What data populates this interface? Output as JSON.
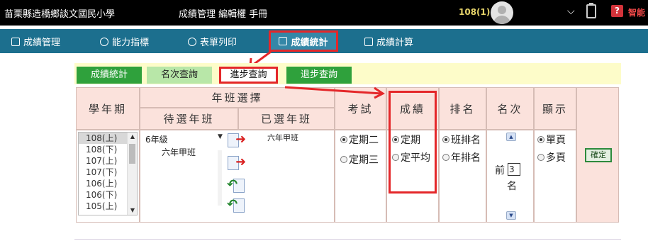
{
  "header": {
    "school": "苗栗縣造橋鄉談文國民小學",
    "system": "成績管理 編輯權 手冊",
    "account_year": "108(1)",
    "smart_label": "智能"
  },
  "nav": {
    "items": [
      {
        "label": "成績管理",
        "icon": "document-icon"
      },
      {
        "label": "能力指標",
        "icon": "target-icon"
      },
      {
        "label": "表單列印",
        "icon": "printer-icon"
      },
      {
        "label": "成績統計",
        "icon": "stats-icon",
        "active": true
      },
      {
        "label": "成績計算",
        "icon": "calculator-icon"
      }
    ]
  },
  "subtabs": [
    {
      "label": "成績統計"
    },
    {
      "label": "名次查詢"
    },
    {
      "label": "進步查詢",
      "active": true
    },
    {
      "label": "退步查詢"
    }
  ],
  "form": {
    "term_label": "學年期",
    "class_select_label": "年班選擇",
    "pending_label": "待選年班",
    "selected_label": "已選年班",
    "exam_label": "考試",
    "score_label": "成績",
    "order_label": "排名",
    "rank_label": "名次",
    "display_label": "顯示",
    "terms": [
      "108(上)",
      "108(下)",
      "107(上)",
      "107(下)",
      "106(上)",
      "106(下)",
      "105(上)",
      "105(下)"
    ],
    "grade_value": "6年級",
    "pending_classes": [
      "六年甲班"
    ],
    "selected_classes": [
      "六年甲班"
    ],
    "exam_options": [
      "定期二",
      "定期三"
    ],
    "score_options": [
      "定期",
      "定平均"
    ],
    "order_options": [
      "班排名",
      "年排名"
    ],
    "rank_prefix": "前",
    "rank_value": "3",
    "rank_suffix": "名",
    "display_options": [
      "單頁",
      "多頁"
    ],
    "confirm_label": "確定"
  }
}
